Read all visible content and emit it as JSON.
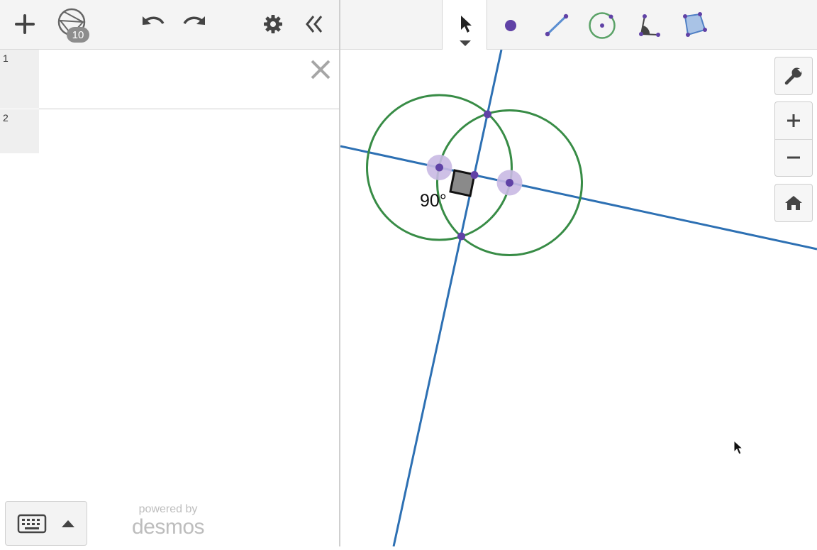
{
  "expressions": {
    "rows": [
      {
        "number": "1",
        "value": ""
      },
      {
        "number": "2",
        "value": ""
      }
    ]
  },
  "toolbar": {
    "geometry_count_badge": "10",
    "icons": [
      "add-icon",
      "geometry-icon",
      "undo-icon",
      "redo-icon",
      "gear-icon",
      "collapse-icon"
    ]
  },
  "footer": {
    "powered_by": "powered by",
    "brand": "desmos"
  },
  "geometry_tools": [
    "select-tool",
    "point-tool",
    "segment-tool",
    "circle-tool",
    "angle-tool",
    "polygon-tool"
  ],
  "graph": {
    "angle_label": "90°",
    "colors": {
      "line": "#2d70b3",
      "circle": "#388c46",
      "point": "#6042a6",
      "point_halo": "#c9b9e3",
      "angle_fill": "#8a8a8a"
    }
  },
  "side_controls": [
    "wrench-icon",
    "zoom-in-icon",
    "zoom-out-icon",
    "home-icon"
  ]
}
